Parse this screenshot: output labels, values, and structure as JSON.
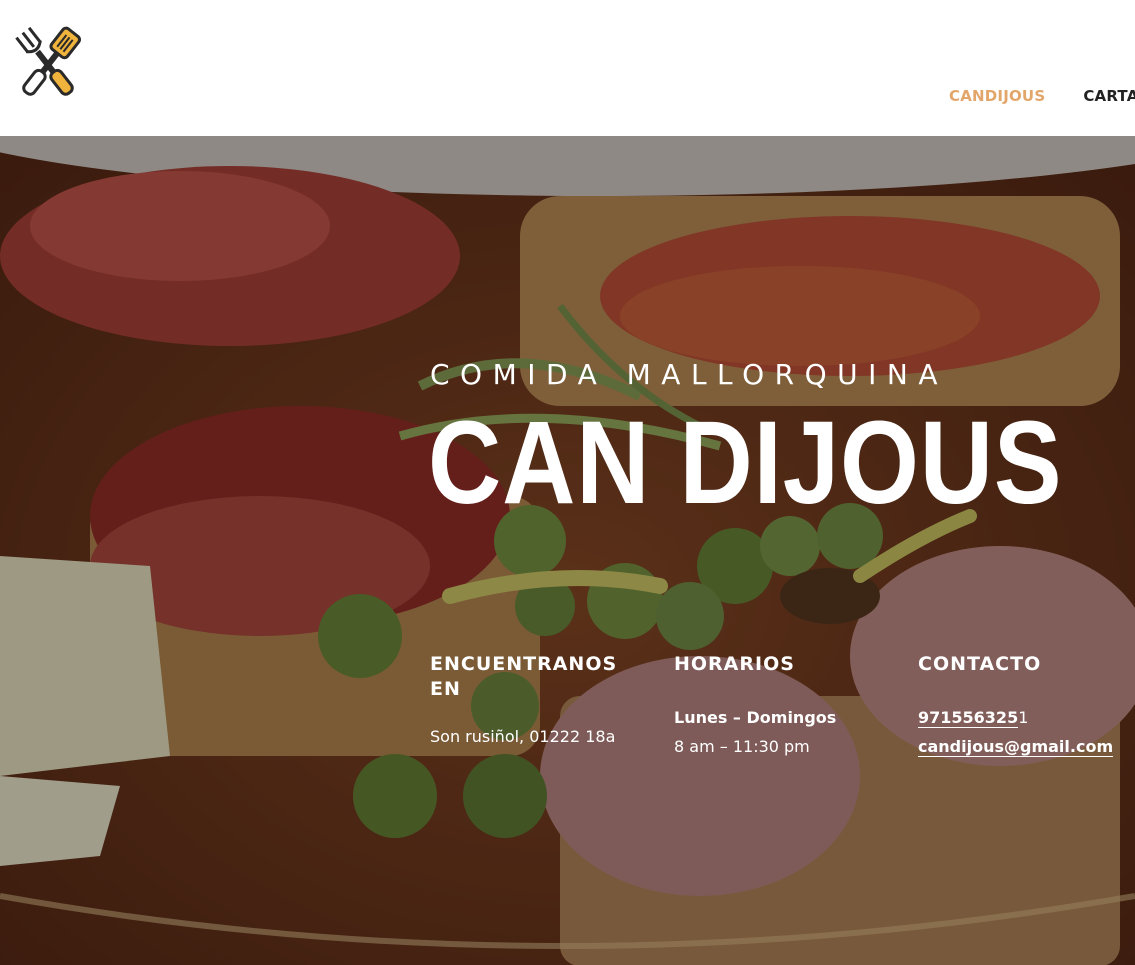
{
  "header": {
    "logo_icon": "crossed-fork-spatula-icon",
    "nav": [
      {
        "label": "CANDIJOUS",
        "color": "#e3a66a"
      },
      {
        "label": "CARTA",
        "color": "#222222"
      }
    ]
  },
  "hero": {
    "kicker": "COMIDA MALLORQUINA",
    "title": "CAN DIJOUS",
    "columns": {
      "location": {
        "heading": "ENCUENTRANOS EN",
        "text": "Son rusiñol, 01222 18a"
      },
      "hours": {
        "heading": "HORARIOS",
        "days": "Lunes – Domingos",
        "time": "8 am – 11:30 pm"
      },
      "contact": {
        "heading": "CONTACTO",
        "phone_link": "971556325",
        "phone_tail": "1",
        "email": "candijous@gmail.com"
      }
    }
  },
  "colors": {
    "accent": "#e3a66a",
    "nav_text": "#222222"
  }
}
